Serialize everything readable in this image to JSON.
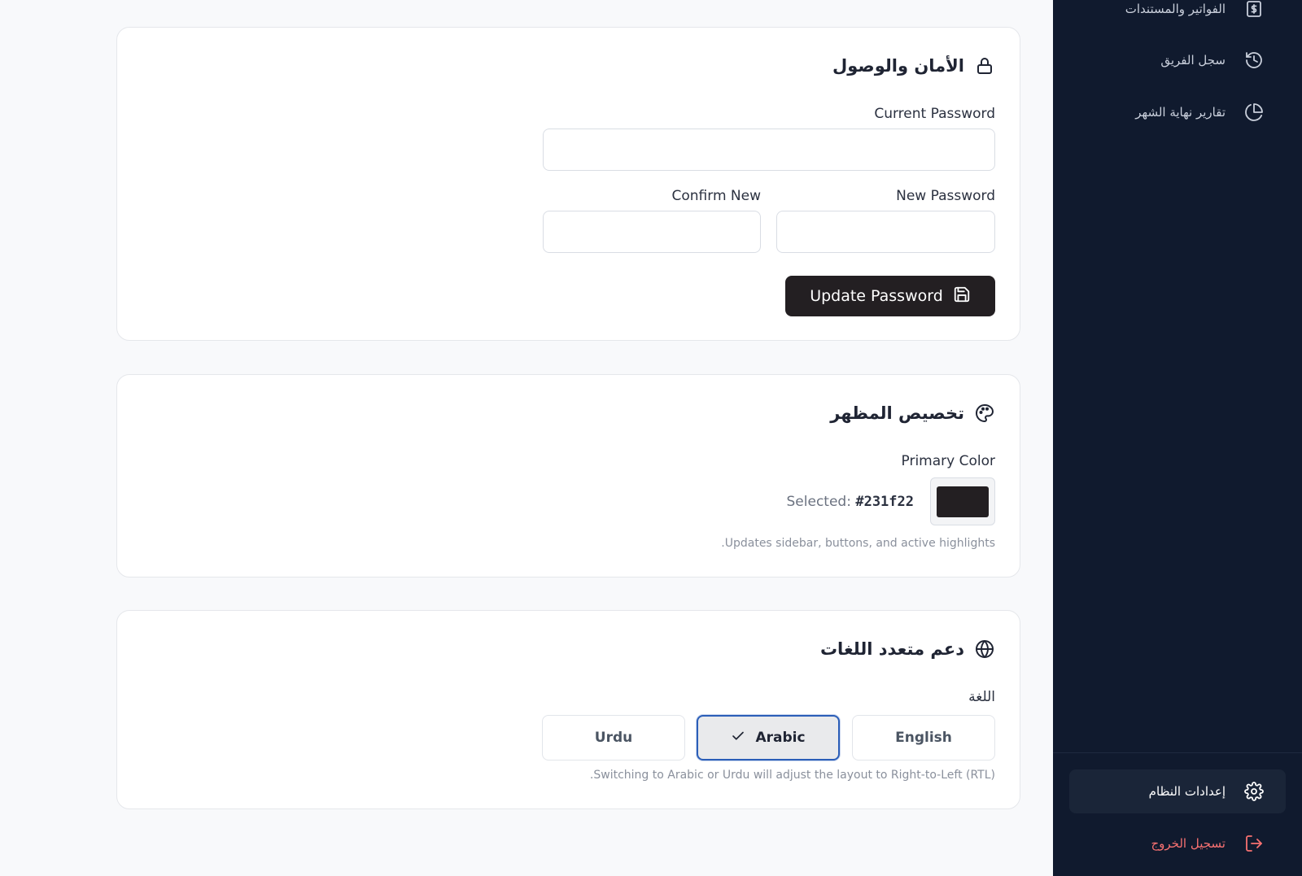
{
  "sidebar": {
    "items": [
      {
        "label": "الفواتير والمستندات",
        "icon": "dollar-document-icon"
      },
      {
        "label": "سجل الفريق",
        "icon": "history-icon"
      },
      {
        "label": "تقارير نهاية الشهر",
        "icon": "pie-chart-icon"
      }
    ],
    "settings_label": "إعدادات النظام",
    "logout_label": "تسجيل الخروج"
  },
  "security": {
    "title": "الأمان والوصول",
    "current_password_label": "Current Password",
    "current_password_value": "",
    "new_password_label": "New Password",
    "new_password_value": "",
    "confirm_label": "Confirm New",
    "confirm_value": "",
    "update_button_label": "Update Password"
  },
  "appearance": {
    "title": "تخصيص المظهر",
    "primary_color_label": "Primary Color",
    "selected_prefix": "Selected:",
    "selected_value": "#231f22",
    "hint": ".Updates sidebar, buttons, and active highlights"
  },
  "language": {
    "title": "دعم متعدد اللغات",
    "label": "اللغة",
    "options": [
      "English",
      "Arabic",
      "Urdu"
    ],
    "selected": "Arabic",
    "hint": ".Switching to Arabic or Urdu will adjust the layout to Right-to-Left (RTL)"
  },
  "colors": {
    "sidebar_bg": "#101a2e",
    "primary": "#231f22",
    "logout": "#f87171",
    "active_border": "#2b5eb8"
  }
}
